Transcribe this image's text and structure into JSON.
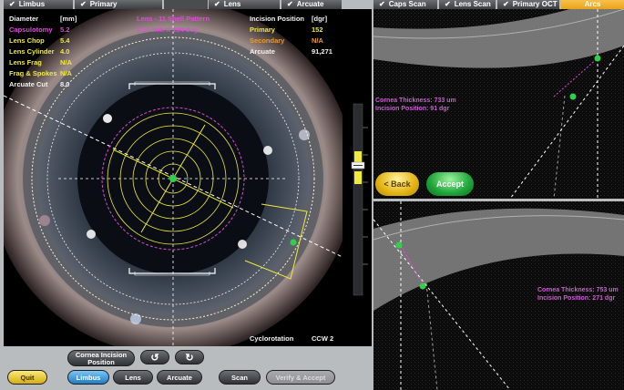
{
  "tabs": [
    {
      "label": "Limbus",
      "checked": true
    },
    {
      "label": "Primary",
      "checked": true
    },
    {
      "label": "Lens",
      "checked": true
    },
    {
      "label": "Arcuate",
      "checked": true
    },
    {
      "label": "Caps Scan",
      "checked": true
    },
    {
      "label": "Lens Scan",
      "checked": true
    },
    {
      "label": "Primary OCT",
      "checked": true
    },
    {
      "label": "Arcs",
      "checked": false
    }
  ],
  "checkmark": "✔",
  "left_info": {
    "header_label": "Diameter",
    "header_unit": "[mm]",
    "rows": [
      {
        "label": "Capsulotomy",
        "value": "5.2"
      },
      {
        "label": "Lens Chop",
        "value": "5.4"
      },
      {
        "label": "Lens Cylinder",
        "value": "4.0"
      },
      {
        "label": "Lens Frag",
        "value": "N/A"
      },
      {
        "label": "Frag & Spokes",
        "value": "N/A"
      },
      {
        "label": "Arcuate Cut",
        "value": "8.0"
      }
    ]
  },
  "center_info": {
    "line1": "Lens - 11 Shell Pattern",
    "line2": "0.10 mm X 104 deg"
  },
  "right_info": {
    "header_label": "Incision Position",
    "header_unit": "[dgr]",
    "rows": [
      {
        "label": "Primary",
        "value": "152"
      },
      {
        "label": "Secondary",
        "value": "N/A"
      },
      {
        "label": "Arcuate",
        "value": "91,271"
      }
    ]
  },
  "cyclorotation": {
    "label": "Cyclorotation",
    "value": "CCW 2"
  },
  "oct_top": {
    "thickness_label": "Cornea Thickness:",
    "thickness_value": "733 um",
    "position_label": "Incision Position:",
    "position_value": "91 dgr"
  },
  "oct_bottom": {
    "thickness_label": "Cornea Thickness:",
    "thickness_value": "753 um",
    "position_label": "Incision Position:",
    "position_value": "271 dgr"
  },
  "buttons": {
    "back": "< Back",
    "accept": "Accept",
    "quit": "Quit",
    "limbus": "Limbus",
    "lens": "Lens",
    "arcuate": "Arcuate",
    "cornea_incision_line1": "Cornea Incision",
    "cornea_incision_line2": "Position",
    "rotate_ccw": "↺",
    "rotate_cw": "↻",
    "scan": "Scan",
    "verify_accept": "Verify & Accept"
  },
  "colors": {
    "accent_yellow": "#f0ea3a",
    "magenta": "#e04ad8",
    "green": "#2fd04a",
    "active_tab": "#f0b030"
  }
}
